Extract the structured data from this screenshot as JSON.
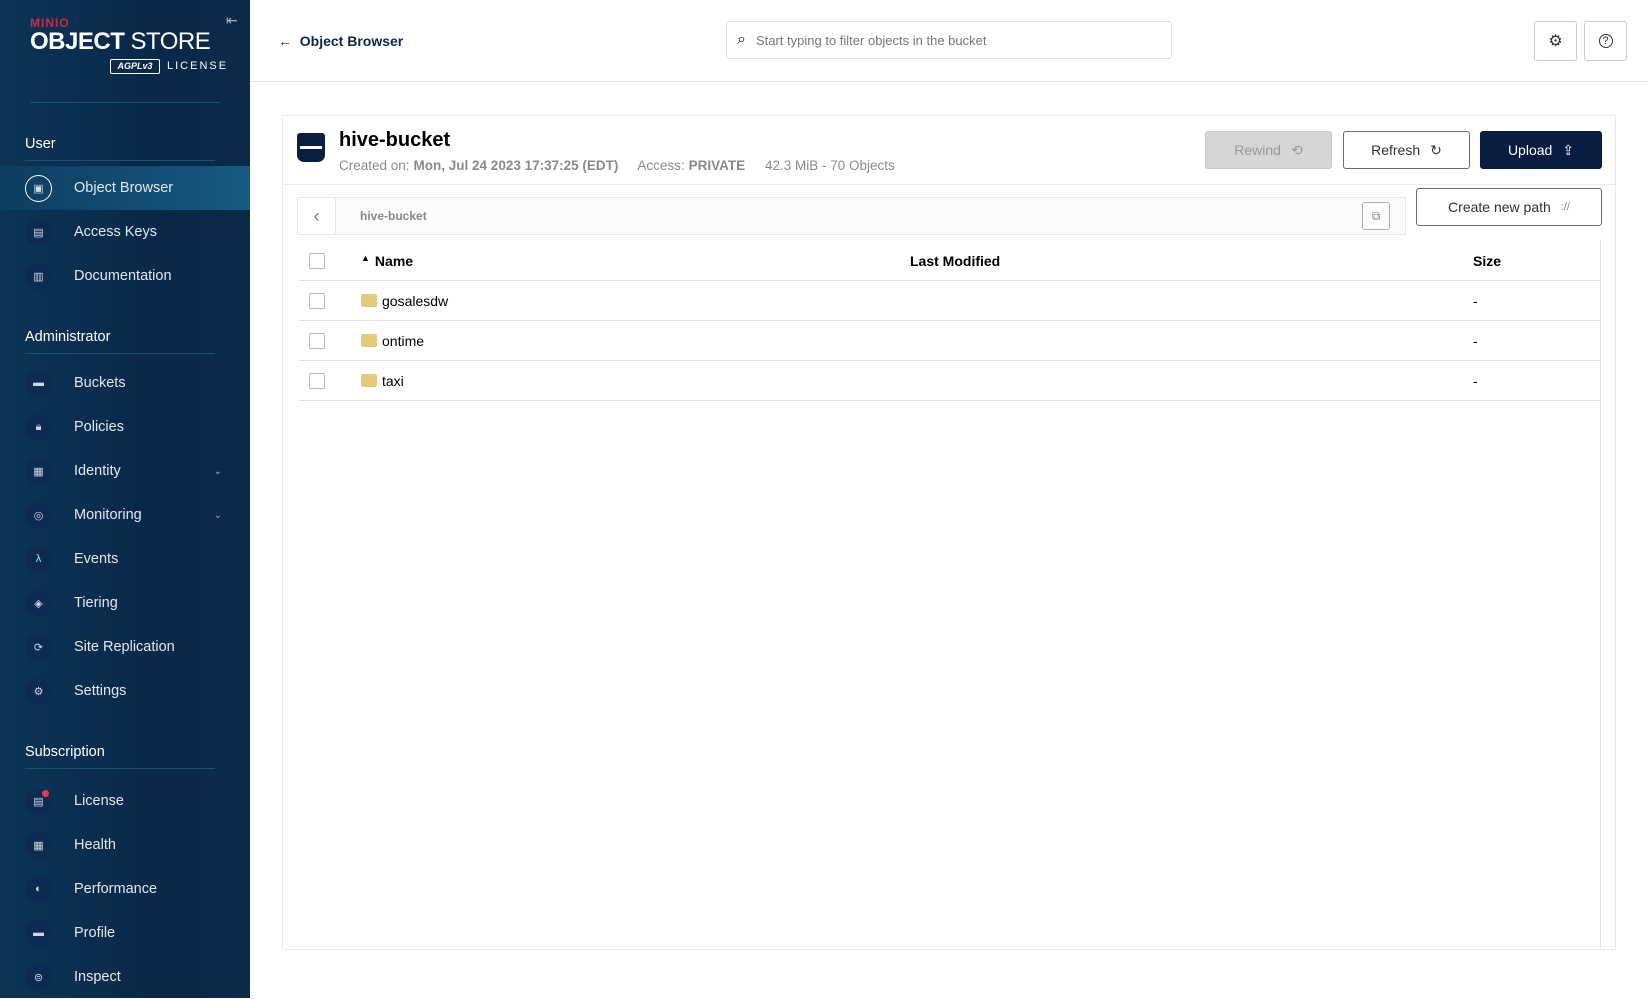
{
  "sidebar": {
    "brand_top": "MINIO",
    "brand_main_bold": "OBJECT",
    "brand_main": "STORE",
    "agpl": "AGPLv3",
    "license": "LICENSE",
    "sections": [
      {
        "label": "User",
        "items": [
          {
            "label": "Object Browser",
            "icon": "object-browser-icon",
            "active": true
          },
          {
            "label": "Access Keys",
            "icon": "access-keys-icon"
          },
          {
            "label": "Documentation",
            "icon": "documentation-icon"
          }
        ]
      },
      {
        "label": "Administrator",
        "items": [
          {
            "label": "Buckets",
            "icon": "bucket-icon"
          },
          {
            "label": "Policies",
            "icon": "lock-icon"
          },
          {
            "label": "Identity",
            "icon": "identity-icon",
            "expandable": true
          },
          {
            "label": "Monitoring",
            "icon": "monitoring-icon",
            "expandable": true
          },
          {
            "label": "Events",
            "icon": "lambda-icon"
          },
          {
            "label": "Tiering",
            "icon": "layers-icon"
          },
          {
            "label": "Site Replication",
            "icon": "replication-icon"
          },
          {
            "label": "Settings",
            "icon": "gear-icon"
          }
        ]
      },
      {
        "label": "Subscription",
        "items": [
          {
            "label": "License",
            "icon": "license-icon",
            "badge": true
          },
          {
            "label": "Health",
            "icon": "health-icon"
          },
          {
            "label": "Performance",
            "icon": "performance-icon"
          },
          {
            "label": "Profile",
            "icon": "profile-icon"
          },
          {
            "label": "Inspect",
            "icon": "inspect-icon"
          }
        ]
      }
    ]
  },
  "topbar": {
    "back_label": "Object Browser",
    "search_placeholder": "Start typing to filter objects in the bucket"
  },
  "bucket": {
    "name": "hive-bucket",
    "created_label": "Created on:",
    "created": "Mon, Jul 24 2023 17:37:25 (EDT)",
    "access_label": "Access:",
    "access": "PRIVATE",
    "summary": "42.3 MiB - 70 Objects"
  },
  "actions": {
    "rewind": "Rewind",
    "refresh": "Refresh",
    "upload": "Upload",
    "create_path": "Create new path"
  },
  "breadcrumb": {
    "path": "hive-bucket"
  },
  "table": {
    "columns": [
      "Name",
      "Last Modified",
      "Size"
    ],
    "rows": [
      {
        "name": "gosalesdw",
        "modified": "",
        "size": "-"
      },
      {
        "name": "ontime",
        "modified": "",
        "size": "-"
      },
      {
        "name": "taxi",
        "modified": "",
        "size": "-"
      }
    ]
  },
  "colors": {
    "sidebar": "#0a2849",
    "primary": "#081c42",
    "folder": "#e6c97d",
    "badge": "#e53950"
  }
}
